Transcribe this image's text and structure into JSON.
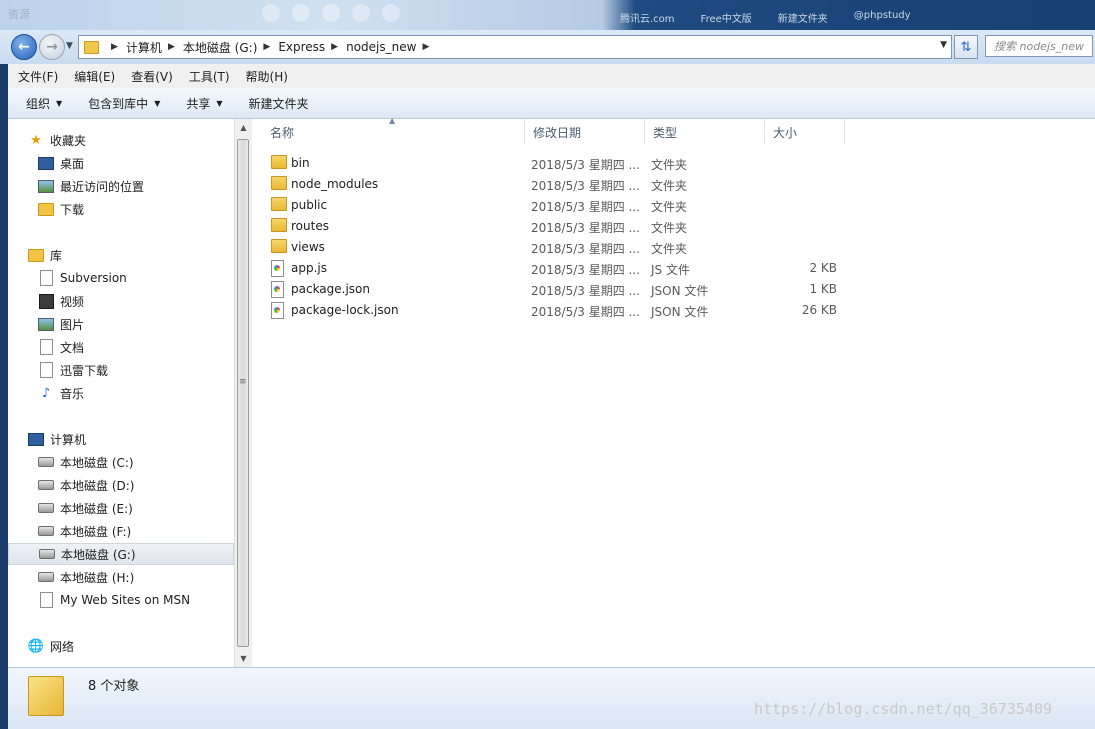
{
  "window": {
    "title": "资源",
    "taskbar_items": [
      "腾讯云.com",
      "Free中文版",
      "新建文件夹",
      "@phpstudy"
    ]
  },
  "address": {
    "crumbs": [
      "计算机",
      "本地磁盘 (G:)",
      "Express",
      "nodejs_new"
    ],
    "search_placeholder": "搜索 nodejs_new"
  },
  "menu": [
    "文件(F)",
    "编辑(E)",
    "查看(V)",
    "工具(T)",
    "帮助(H)"
  ],
  "toolbar": {
    "organize": "组织",
    "include_library": "包含到库中",
    "share": "共享",
    "new_folder": "新建文件夹"
  },
  "sidebar": {
    "favorites": {
      "title": "收藏夹",
      "items": [
        {
          "label": "桌面",
          "icon": "desktop-icon"
        },
        {
          "label": "最近访问的位置",
          "icon": "recent-places-icon"
        },
        {
          "label": "下载",
          "icon": "downloads-icon"
        }
      ]
    },
    "libraries": {
      "title": "库",
      "items": [
        {
          "label": "Subversion",
          "icon": "document-icon"
        },
        {
          "label": "视频",
          "icon": "video-icon"
        },
        {
          "label": "图片",
          "icon": "pictures-icon"
        },
        {
          "label": "文档",
          "icon": "document-icon"
        },
        {
          "label": "迅雷下载",
          "icon": "document-icon"
        },
        {
          "label": "音乐",
          "icon": "music-icon"
        }
      ]
    },
    "computer": {
      "title": "计算机",
      "items": [
        {
          "label": "本地磁盘 (C:)",
          "icon": "system-drive-icon"
        },
        {
          "label": "本地磁盘 (D:)",
          "icon": "drive-icon"
        },
        {
          "label": "本地磁盘 (E:)",
          "icon": "drive-icon"
        },
        {
          "label": "本地磁盘 (F:)",
          "icon": "drive-icon"
        },
        {
          "label": "本地磁盘 (G:)",
          "icon": "drive-icon",
          "selected": true
        },
        {
          "label": "本地磁盘 (H:)",
          "icon": "drive-icon"
        },
        {
          "label": "My Web Sites on MSN",
          "icon": "document-icon"
        }
      ]
    },
    "network": {
      "title": "网络"
    }
  },
  "columns": {
    "name": "名称",
    "date": "修改日期",
    "type": "类型",
    "size": "大小"
  },
  "files": [
    {
      "name": "bin",
      "date": "2018/5/3 星期四 ...",
      "type": "文件夹",
      "size": "",
      "kind": "folder"
    },
    {
      "name": "node_modules",
      "date": "2018/5/3 星期四 ...",
      "type": "文件夹",
      "size": "",
      "kind": "folder"
    },
    {
      "name": "public",
      "date": "2018/5/3 星期四 ...",
      "type": "文件夹",
      "size": "",
      "kind": "folder"
    },
    {
      "name": "routes",
      "date": "2018/5/3 星期四 ...",
      "type": "文件夹",
      "size": "",
      "kind": "folder"
    },
    {
      "name": "views",
      "date": "2018/5/3 星期四 ...",
      "type": "文件夹",
      "size": "",
      "kind": "folder"
    },
    {
      "name": "app.js",
      "date": "2018/5/3 星期四 ...",
      "type": "JS 文件",
      "size": "2 KB",
      "kind": "file"
    },
    {
      "name": "package.json",
      "date": "2018/5/3 星期四 ...",
      "type": "JSON 文件",
      "size": "1 KB",
      "kind": "file"
    },
    {
      "name": "package-lock.json",
      "date": "2018/5/3 星期四 ...",
      "type": "JSON 文件",
      "size": "26 KB",
      "kind": "file"
    }
  ],
  "status": {
    "count": "8 个对象",
    "watermark": "https://blog.csdn.net/qq_36735409"
  }
}
